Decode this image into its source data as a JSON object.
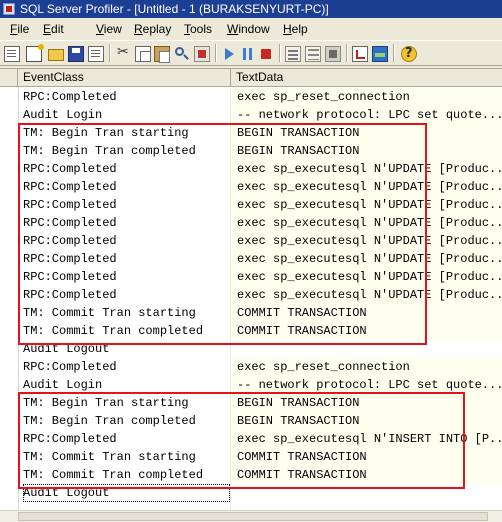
{
  "window": {
    "title": "SQL Server Profiler - [Untitled - 1 (BURAKSENYURT-PC)]"
  },
  "menu": [
    {
      "mnemonic": "F",
      "rest": "ile"
    },
    {
      "mnemonic": "E",
      "rest": "dit"
    },
    {
      "mnemonic": "V",
      "rest": "iew"
    },
    {
      "mnemonic": "R",
      "rest": "eplay"
    },
    {
      "mnemonic": "T",
      "rest": "ools"
    },
    {
      "mnemonic": "W",
      "rest": "indow"
    },
    {
      "mnemonic": "H",
      "rest": "elp"
    }
  ],
  "toolbar": {
    "icons": [
      "new-trace-icon",
      "new-template-icon",
      "open-icon",
      "save-icon",
      "properties-icon",
      "cut-icon",
      "copy-icon",
      "paste-icon",
      "find-icon",
      "clear-trace-icon",
      "run-icon",
      "pause-icon",
      "stop-icon",
      "event-properties-icon",
      "filter-icon",
      "auto-scroll-icon",
      "tuning-advisor-icon",
      "performance-monitor-icon",
      "help-icon"
    ]
  },
  "grid": {
    "columns": [
      "EventClass",
      "TextData"
    ],
    "rows": [
      {
        "event": "RPC:Completed",
        "text": "exec sp_reset_connection"
      },
      {
        "event": "Audit Login",
        "text": "-- network protocol: LPC  set quote..."
      },
      {
        "event": "TM: Begin Tran starting",
        "text": "BEGIN TRANSACTION"
      },
      {
        "event": "TM: Begin Tran completed",
        "text": "BEGIN TRANSACTION"
      },
      {
        "event": "RPC:Completed",
        "text": "exec sp_executesql N'UPDATE [Produc..."
      },
      {
        "event": "RPC:Completed",
        "text": "exec sp_executesql N'UPDATE [Produc..."
      },
      {
        "event": "RPC:Completed",
        "text": "exec sp_executesql N'UPDATE [Produc..."
      },
      {
        "event": "RPC:Completed",
        "text": "exec sp_executesql N'UPDATE [Produc..."
      },
      {
        "event": "RPC:Completed",
        "text": "exec sp_executesql N'UPDATE [Produc..."
      },
      {
        "event": "RPC:Completed",
        "text": "exec sp_executesql N'UPDATE [Produc..."
      },
      {
        "event": "RPC:Completed",
        "text": "exec sp_executesql N'UPDATE [Produc..."
      },
      {
        "event": "RPC:Completed",
        "text": "exec sp_executesql N'UPDATE [Produc..."
      },
      {
        "event": "TM: Commit Tran starting",
        "text": "COMMIT TRANSACTION"
      },
      {
        "event": "TM: Commit Tran completed",
        "text": "COMMIT TRANSACTION"
      },
      {
        "event": "Audit Logout",
        "text": ""
      },
      {
        "event": "RPC:Completed",
        "text": "exec sp_reset_connection"
      },
      {
        "event": "Audit Login",
        "text": "-- network protocol: LPC  set quote..."
      },
      {
        "event": "TM: Begin Tran starting",
        "text": "BEGIN TRANSACTION"
      },
      {
        "event": "TM: Begin Tran completed",
        "text": "BEGIN TRANSACTION"
      },
      {
        "event": "RPC:Completed",
        "text": "exec sp_executesql N'INSERT INTO [P..."
      },
      {
        "event": "TM: Commit Tran starting",
        "text": "COMMIT TRANSACTION"
      },
      {
        "event": "TM: Commit Tran completed",
        "text": "COMMIT TRANSACTION"
      },
      {
        "event": "Audit Logout",
        "text": ""
      }
    ]
  },
  "highlight_color": "#e8111b"
}
